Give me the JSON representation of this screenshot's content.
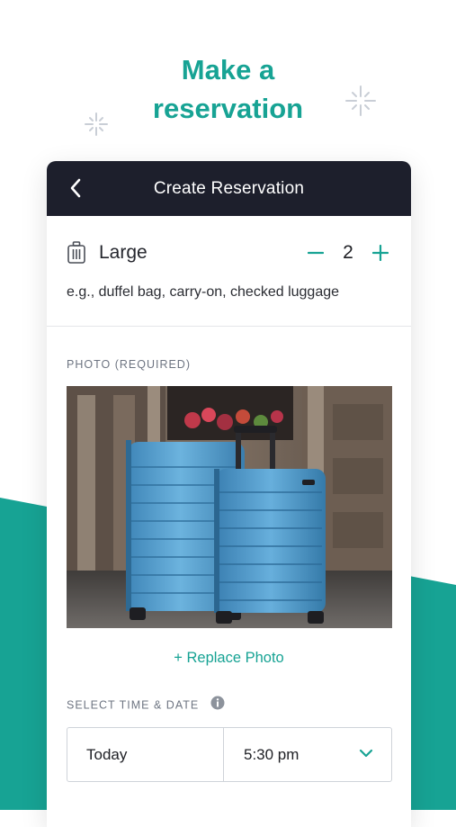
{
  "headline": {
    "line1": "Make a",
    "line2": "reservation"
  },
  "colors": {
    "accent": "#17a394",
    "header_bg": "#1d1f2c",
    "sparkle": "#c9ced6"
  },
  "card": {
    "header": {
      "back_icon": "chevron-left-icon",
      "title": "Create Reservation"
    },
    "bag": {
      "icon": "luggage-icon",
      "size_label": "Large",
      "quantity": "2",
      "decrement_icon": "minus-icon",
      "increment_icon": "plus-icon",
      "description": "e.g., duffel bag, carry-on, checked luggage"
    },
    "photo": {
      "label": "PHOTO (REQUIRED)",
      "replace_label": "+ Replace Photo"
    },
    "schedule": {
      "label": "SELECT TIME & DATE",
      "info_icon": "info-icon",
      "date_value": "Today",
      "time_value": "5:30 pm",
      "dropdown_icon": "chevron-down-icon"
    }
  }
}
